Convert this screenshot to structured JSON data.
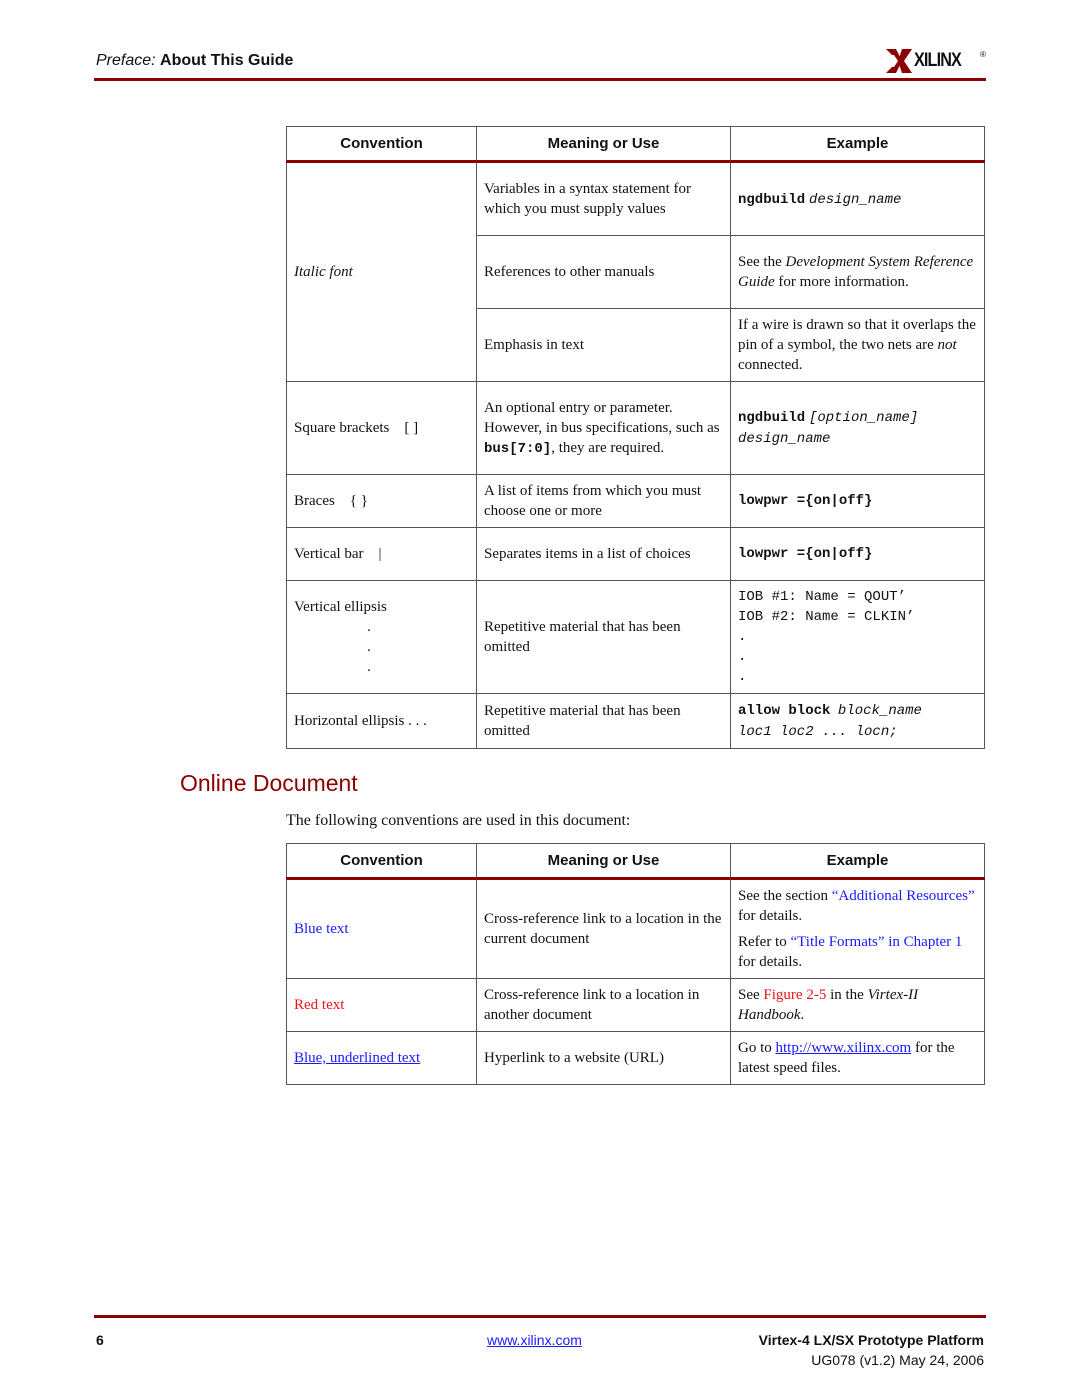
{
  "header": {
    "prefix": "Preface:",
    "title": "About This Guide",
    "logo_text": "XILINX",
    "logo_reg": "®"
  },
  "table1": {
    "headers": [
      "Convention",
      "Meaning or Use",
      "Example"
    ],
    "italic": {
      "convention": "Italic font",
      "r1_meaning": "Variables in a syntax statement for which you must supply values",
      "r1_ex_bold": "ngdbuild",
      "r1_ex_it": "design_name",
      "r2_meaning": "References to other manuals",
      "r2_ex_a": "See the",
      "r2_ex_it": "Development System Reference Guide",
      "r2_ex_b": "for more information.",
      "r3_meaning": "Emphasis in text",
      "r3_ex_a": "If a wire is drawn so that it overlaps the pin of a symbol, the two nets are",
      "r3_ex_it": "not",
      "r3_ex_b": "connected."
    },
    "square": {
      "convention": "Square brackets    [ ]",
      "meaning_a": "An optional entry or parameter. However, in bus specifications, such as",
      "meaning_code": "bus[7:0]",
      "meaning_b": ", they are required.",
      "ex_bold": "ngdbuild",
      "ex_rest": "[option_name]",
      "ex_line2": "design_name"
    },
    "braces": {
      "convention": "Braces    { }",
      "meaning": "A list of items from which you must choose one or more",
      "ex": "lowpwr ={on|off}"
    },
    "vbar": {
      "convention": "Vertical bar    |",
      "meaning": "Separates items in a list of choices",
      "ex": "lowpwr ={on|off}"
    },
    "vellipsis": {
      "convention": "Vertical ellipsis",
      "dot": ".",
      "meaning": "Repetitive material that has been omitted",
      "ex1": "IOB #1: Name = QOUT’",
      "ex2": "IOB #2: Name = CLKIN’",
      "exdot": "."
    },
    "hellipsis": {
      "convention": "Horizontal ellipsis . . .",
      "meaning": "Repetitive material that has been omitted",
      "ex_bold": "allow block",
      "ex_it": "block_name",
      "ex2": "loc1 loc2 ... locn;"
    }
  },
  "section": {
    "title": "Online Document",
    "intro": "The following conventions are used in this document:"
  },
  "table2": {
    "headers": [
      "Convention",
      "Meaning or Use",
      "Example"
    ],
    "blue": {
      "convention": "Blue text",
      "meaning": "Cross-reference link to a location in the current document",
      "ex1_a": "See the section",
      "ex1_link": "“Additional Resources”",
      "ex1_b": "for details.",
      "ex2_a": "Refer to",
      "ex2_link": "“Title Formats” in Chapter 1",
      "ex2_b": "for details."
    },
    "red": {
      "convention": "Red text",
      "meaning": "Cross-reference link to a location in another document",
      "ex_a": "See",
      "ex_link": "Figure 2-5",
      "ex_b": "in the",
      "ex_it": "Virtex-II Handbook",
      "ex_c": "."
    },
    "url": {
      "convention": "Blue, underlined text",
      "meaning": "Hyperlink to a website (URL)",
      "ex_a": "Go to",
      "ex_link": "http://www.xilinx.com",
      "ex_b": "for the latest speed files."
    }
  },
  "footer": {
    "page": "6",
    "url": "www.xilinx.com",
    "title": "Virtex-4 LX/SX Prototype Platform",
    "revision": "UG078 (v1.2)  May 24, 2006"
  }
}
